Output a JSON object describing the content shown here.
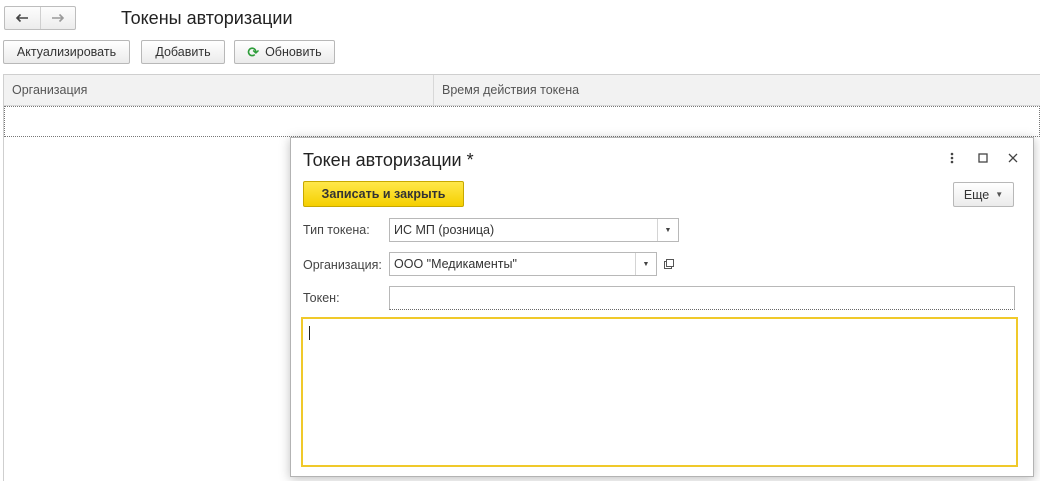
{
  "header": {
    "title": "Токены авторизации",
    "back_icon": "arrow-left-icon",
    "forward_icon": "arrow-right-icon"
  },
  "toolbar": {
    "actualize_label": "Актуализировать",
    "add_label": "Добавить",
    "refresh_label": "Обновить"
  },
  "table": {
    "columns": [
      "Организация",
      "Время действия токена"
    ]
  },
  "dialog": {
    "title": "Токен авторизации *",
    "save_close_label": "Записать и закрыть",
    "more_label": "Еще",
    "fields": {
      "token_type": {
        "label": "Тип токена:",
        "value": "ИС МП (розница)"
      },
      "organization": {
        "label": "Организация:",
        "value": "ООО \"Медикаменты\""
      },
      "token": {
        "label": "Токен:",
        "value": ""
      }
    },
    "text_value": ""
  },
  "colors": {
    "primary_button": "#f5cf00",
    "focus_border": "#f0c92a",
    "refresh_icon": "#2e9d3a"
  }
}
